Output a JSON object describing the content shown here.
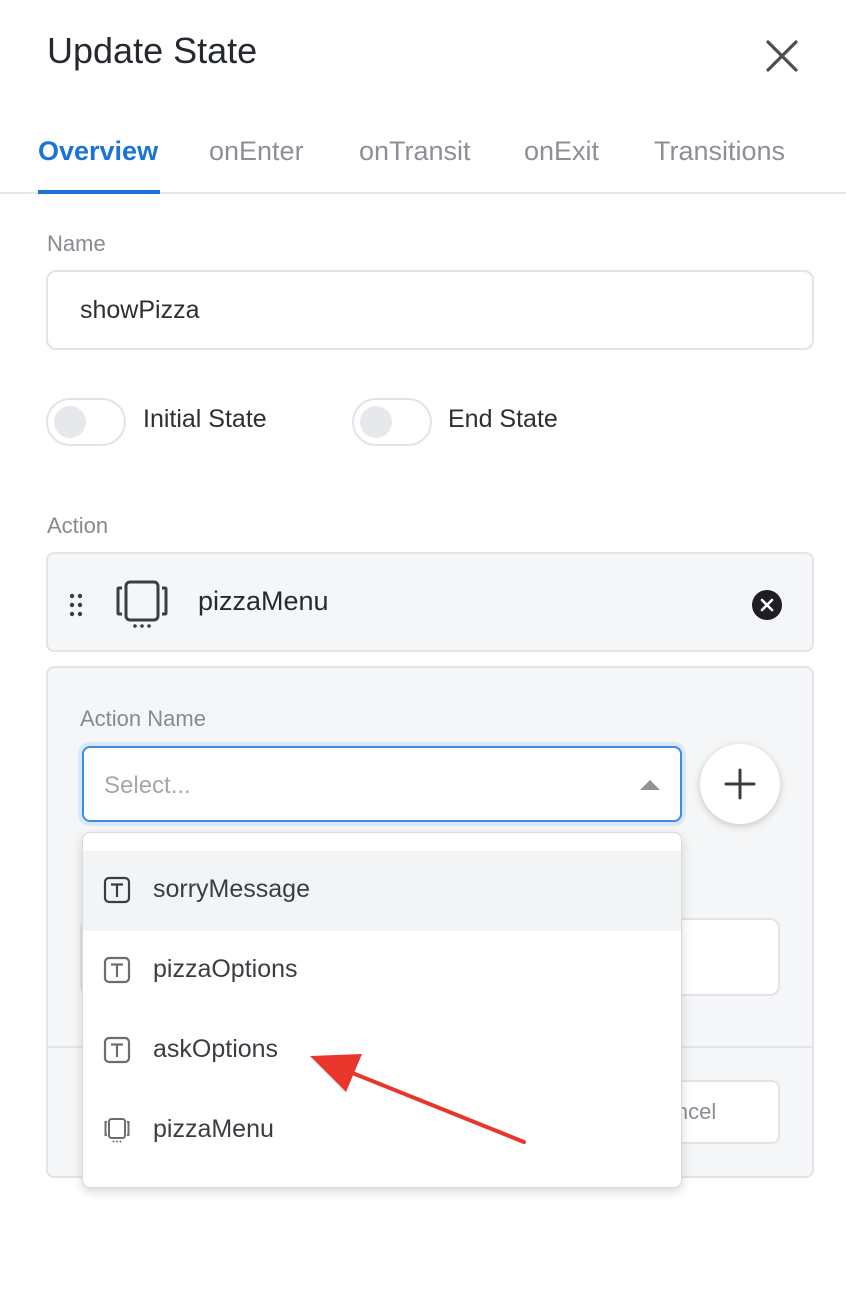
{
  "header": {
    "title": "Update State"
  },
  "tabs": [
    {
      "label": "Overview",
      "active": true
    },
    {
      "label": "onEnter",
      "active": false
    },
    {
      "label": "onTransit",
      "active": false
    },
    {
      "label": "onExit",
      "active": false
    },
    {
      "label": "Transitions",
      "active": false
    }
  ],
  "form": {
    "name_label": "Name",
    "name_value": "showPizza",
    "initial_state": {
      "label": "Initial State",
      "on": false
    },
    "end_state": {
      "label": "End State",
      "on": false
    },
    "action_label": "Action"
  },
  "action_card": {
    "name": "pizzaMenu",
    "icon": "screen-icon"
  },
  "action_editor": {
    "action_name_label": "Action Name",
    "select_placeholder": "Select...",
    "cancel_label": "Cancel"
  },
  "dropdown": {
    "options": [
      {
        "label": "sorryMessage",
        "icon": "text-icon",
        "highlighted": true
      },
      {
        "label": "pizzaOptions",
        "icon": "text-icon",
        "highlighted": false
      },
      {
        "label": "askOptions",
        "icon": "text-icon",
        "highlighted": false
      },
      {
        "label": "pizzaMenu",
        "icon": "screen-icon",
        "highlighted": false
      }
    ]
  },
  "colors": {
    "accent": "#1a73d9",
    "annotation_arrow": "#e8362d"
  }
}
